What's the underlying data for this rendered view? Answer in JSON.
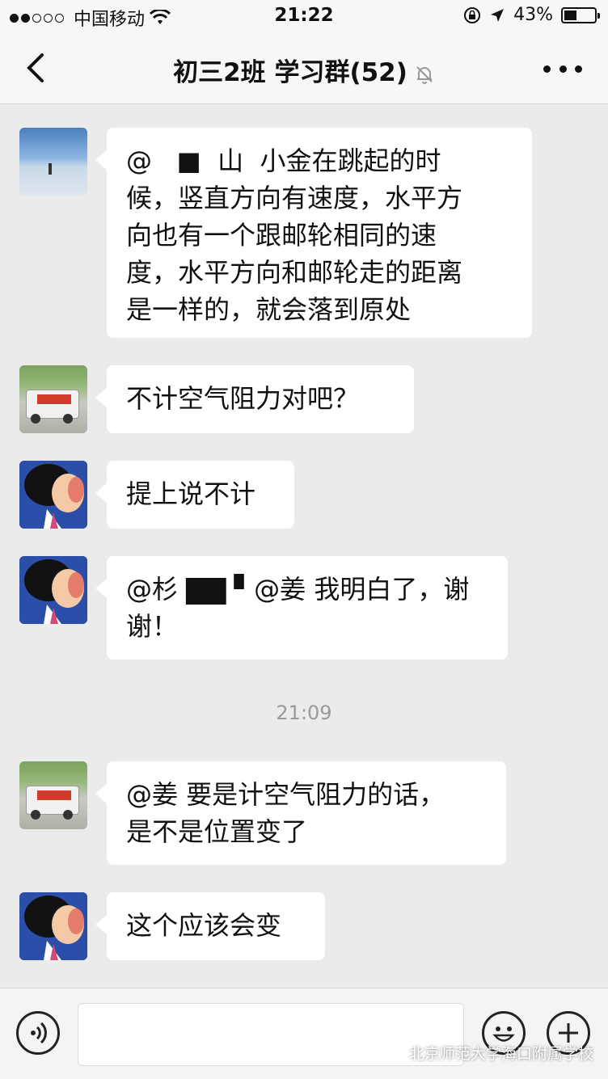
{
  "status_bar": {
    "carrier": "中国移动",
    "time": "21:22",
    "battery": "43%",
    "battery_level": 0.43
  },
  "nav": {
    "title": "初三2班  学习群(52)"
  },
  "messages": [
    {
      "text": "@   ■  山  小金在跳起的时\n候，竖直方向有速度，水平方\n向也有一个跟邮轮相同的速\n度，水平方向和邮轮走的距离\n是一样的，就会落到原处"
    },
    {
      "text": "不计空气阻力对吧？"
    },
    {
      "text": "提上说不计"
    },
    {
      "text": "@杉 ▇▇ ▘@姜 我明白了，谢\n谢！"
    },
    {
      "text": "@姜 要是计空气阻力的话，\n是不是位置变了"
    },
    {
      "text": "这个应该会变"
    }
  ],
  "timestamp": "21:09",
  "watermark": "北京师范大学海口附属学校"
}
